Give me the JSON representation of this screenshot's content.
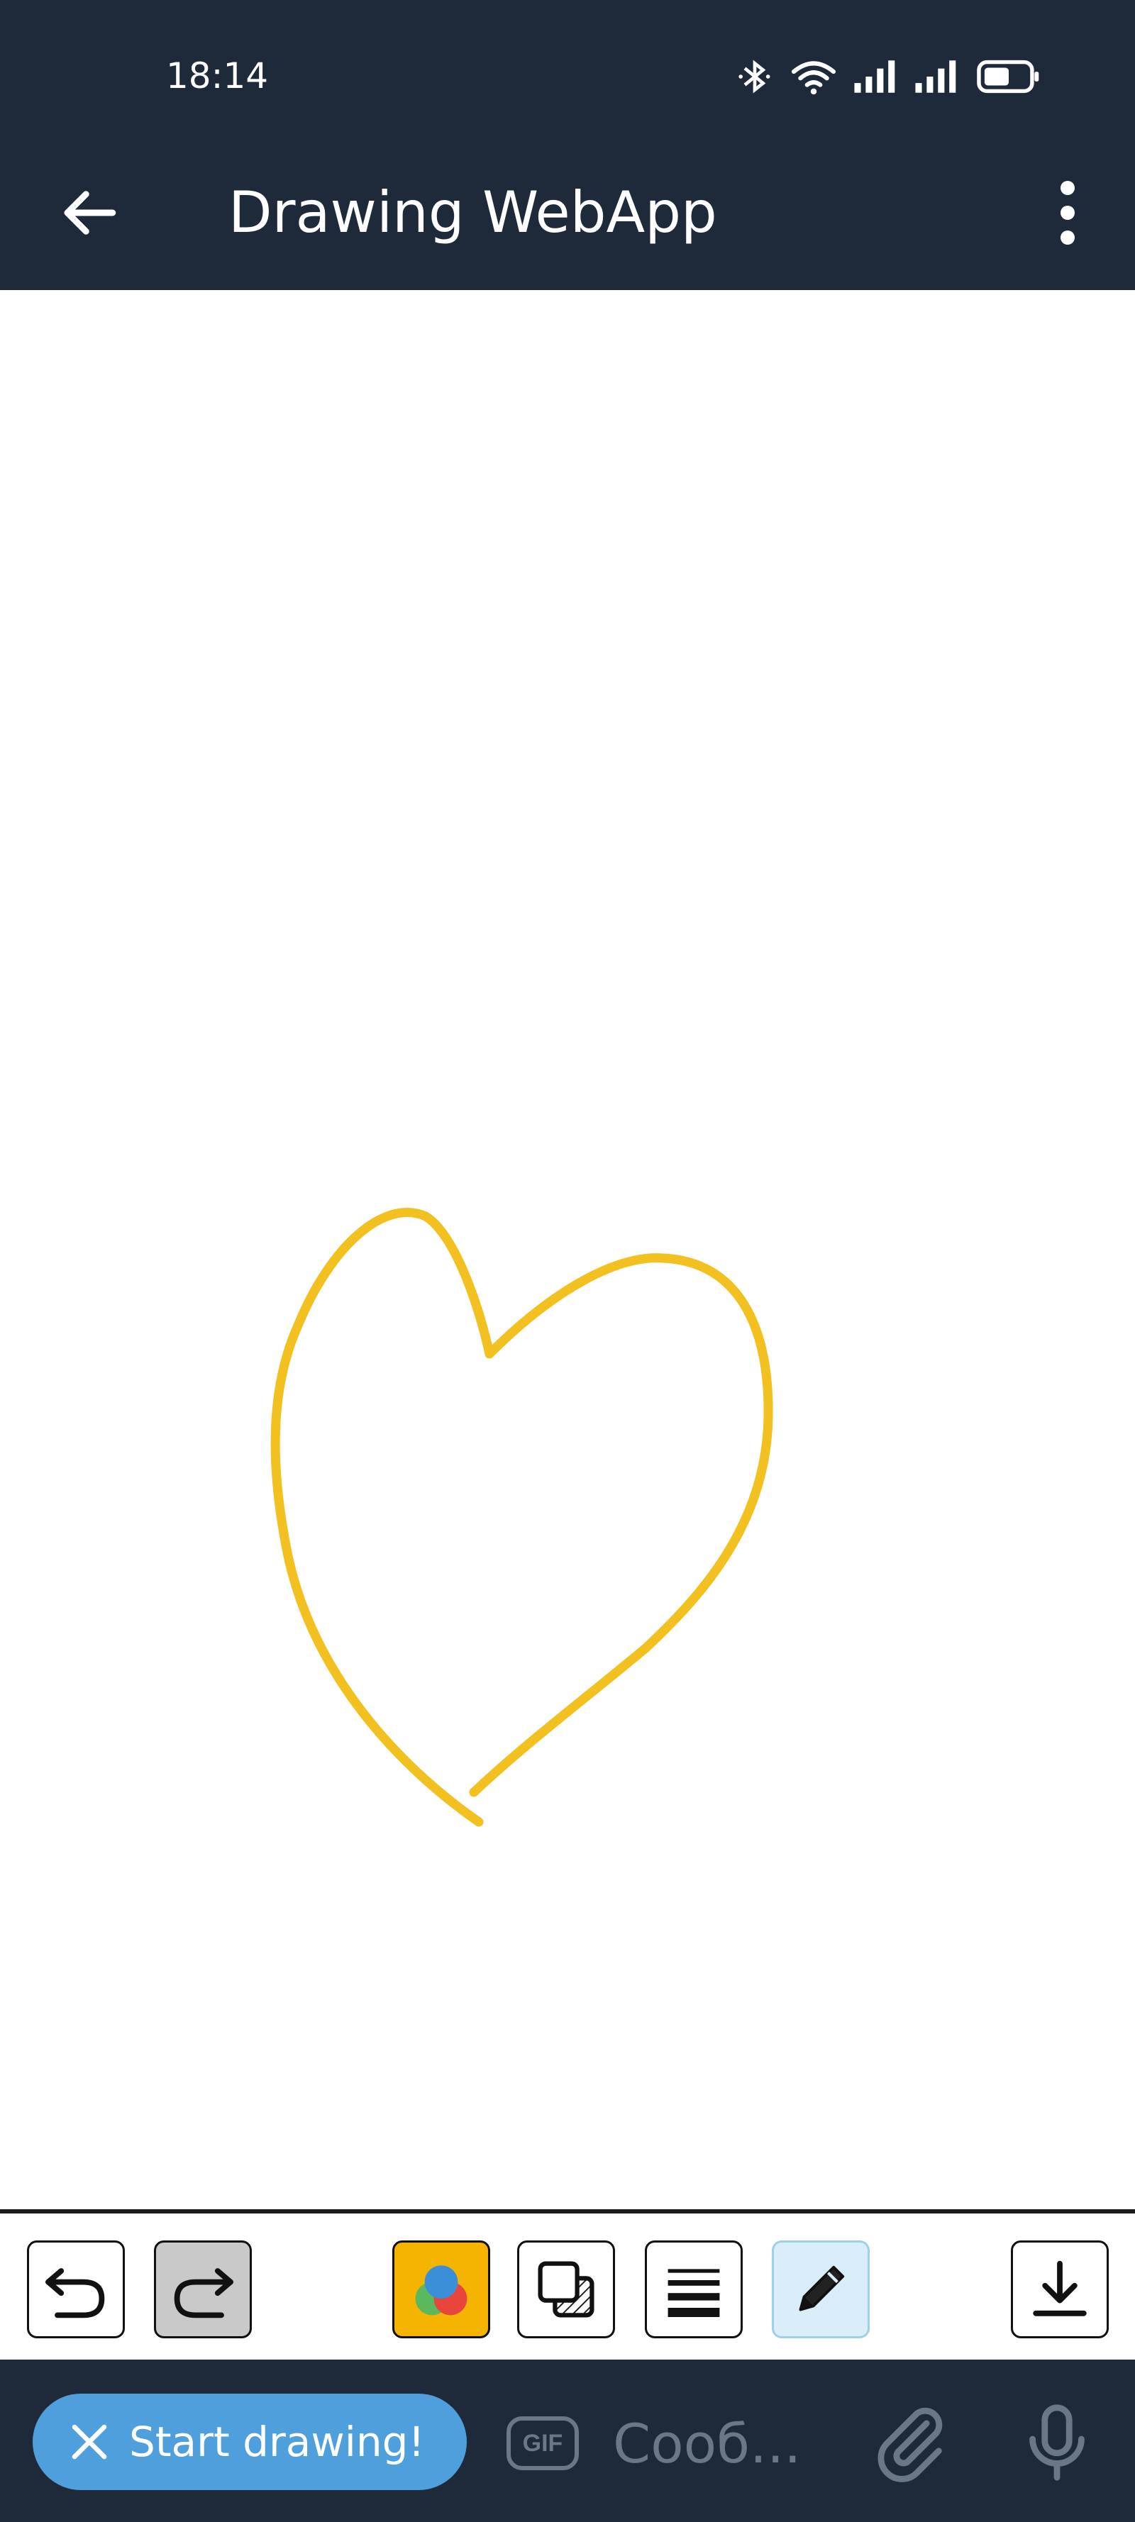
{
  "status_bar": {
    "time": "18:14",
    "icons": [
      "bluetooth-icon",
      "wifi-icon",
      "signal-icon",
      "signal-icon",
      "battery-icon"
    ]
  },
  "app_bar": {
    "title": "Drawing WebApp",
    "back_icon": "arrow-left-icon",
    "menu_icon": "more-vertical-icon"
  },
  "canvas": {
    "stroke_color": "#f2c01f",
    "background": "#ffffff"
  },
  "toolbar": {
    "tools": [
      "undo",
      "redo",
      "color-picker",
      "layers",
      "stroke-width",
      "pencil",
      "download"
    ],
    "active_tool": "pencil",
    "selected_color": "#f4b400"
  },
  "bottom_bar": {
    "start_drawing_label": "Start drawing!",
    "gif_label": "GIF",
    "message_placeholder": "Сооб...",
    "accent": "#4f9fdd"
  }
}
